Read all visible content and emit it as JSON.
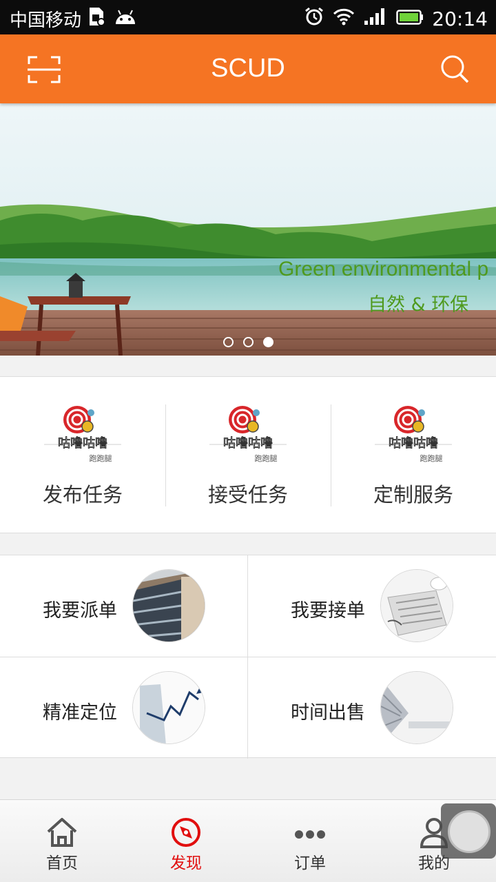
{
  "status_bar": {
    "carrier": "中国移动",
    "time": "20:14"
  },
  "header": {
    "title": "SCUD"
  },
  "banner": {
    "headline": "Green environmental p",
    "subline": "自然 & 环保",
    "slide_count": 3,
    "active_slide": 3
  },
  "services": [
    {
      "label": "发布任务"
    },
    {
      "label": "接受任务"
    },
    {
      "label": "定制服务"
    }
  ],
  "grid": [
    {
      "label": "我要派单"
    },
    {
      "label": "我要接单"
    },
    {
      "label": "精准定位"
    },
    {
      "label": "时间出售"
    }
  ],
  "tabs": [
    {
      "label": "首页",
      "active": false
    },
    {
      "label": "发现",
      "active": true
    },
    {
      "label": "订单",
      "active": false
    },
    {
      "label": "我的",
      "active": false
    }
  ],
  "colors": {
    "accent": "#f57423",
    "tab_active": "#e10e0e"
  }
}
